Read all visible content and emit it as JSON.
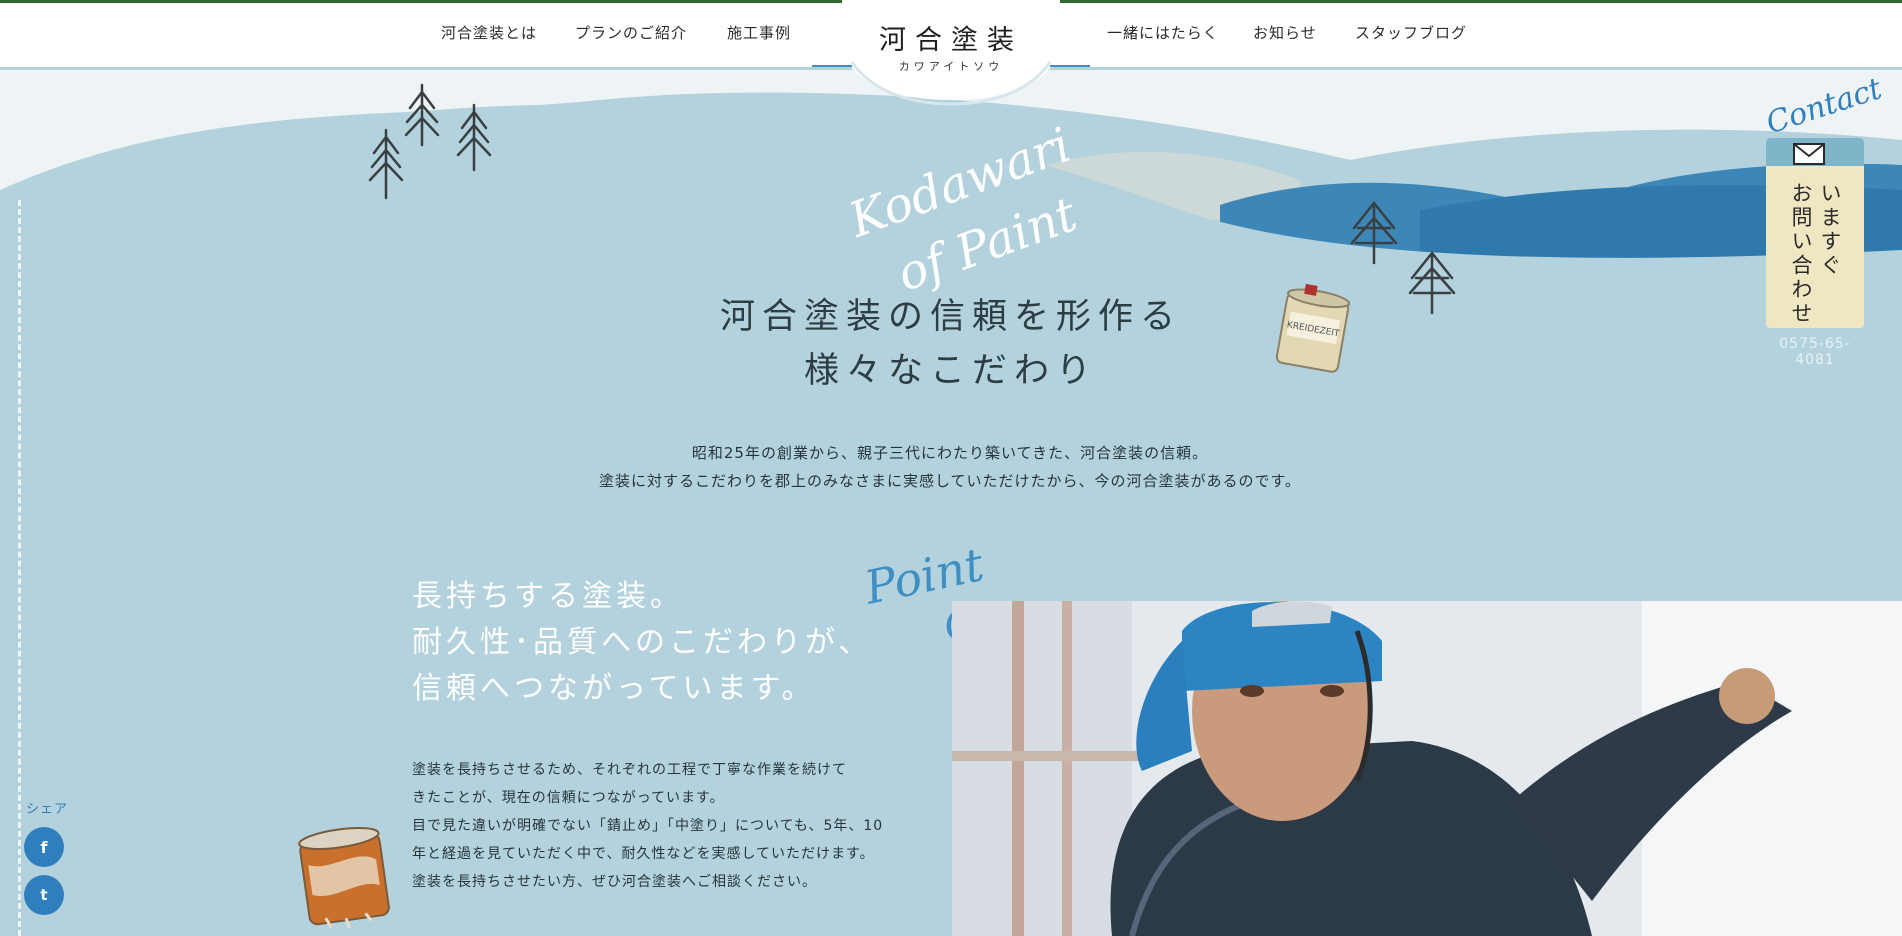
{
  "nav": {
    "left": [
      "河合塗装とは",
      "プランのご紹介",
      "施工事例"
    ],
    "right": [
      "一緒にはたらく",
      "お知らせ",
      "スタッフブログ"
    ]
  },
  "logo": {
    "title": "河合塗装",
    "subtitle": "カワアイトソウ"
  },
  "hero": {
    "script_line1": "Kodawari",
    "script_line2": "of Paint",
    "heading_line1": "河合塗装の信頼を形作る",
    "heading_line2": "様々なこだわり",
    "intro_line1": "昭和25年の創業から、親子三代にわたり築いてきた、河合塗装の信頼。",
    "intro_line2": "塗装に対するこだわりを郡上のみなさまに実感していただけたから、今の河合塗装があるのです。"
  },
  "point_one": {
    "script_word1": "Point",
    "script_word2": "One",
    "title_line1": "長持ちする塗装。",
    "title_line2": "耐久性･品質へのこだわりが、",
    "title_line3": "信頼へつながっています。",
    "body_line1": "塗装を長持ちさせるため、それぞれの工程で丁寧な作業を続けて",
    "body_line2": "きたことが、現在の信頼につながっています。",
    "body_line3": "目で見た違いが明確でない「錆止め」「中塗り」についても、5年、10",
    "body_line4": "年と経過を見ていただく中で、耐久性などを実感していただけます。",
    "body_line5": "塗装を長持ちさせたい方、ぜひ河合塗装へご相談ください。"
  },
  "share": {
    "label": "シェア",
    "facebook": "f",
    "twitter": "t"
  },
  "contact": {
    "script": "Contact",
    "line1": "いますぐ",
    "line2": "お問い合わせ",
    "phone": "0575-65-4081"
  },
  "can_label": "KREIDEZEIT",
  "colors": {
    "bg": "#b3d2de",
    "accent": "#2f7fbf",
    "deep_blue": "#3f8fc2"
  }
}
